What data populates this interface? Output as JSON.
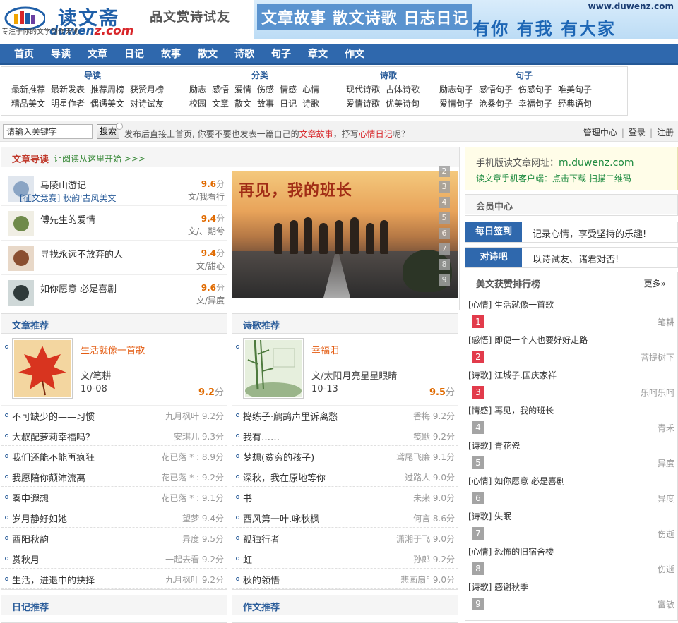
{
  "header": {
    "logo_cn": "读文斋",
    "logo_en_a": "duwen",
    "logo_en_b": "z.com",
    "logo_sub": "专注于你的文学创作天地",
    "slogan": "品文赏诗试友",
    "banner_left": "文章故事 散文诗歌 日志日记",
    "banner_url": "www.duwenz.com",
    "banner_right": "有你 有我 有大家"
  },
  "nav": [
    "首页",
    "导读",
    "文章",
    "日记",
    "故事",
    "散文",
    "诗歌",
    "句子",
    "章文",
    "作文"
  ],
  "categories": [
    {
      "title": "导读",
      "rows": [
        [
          "最新推荐",
          "最新发表",
          "推荐周榜",
          "获赞月榜"
        ],
        [
          "精品美文",
          "明星作者",
          "偶遇美文",
          "对诗试友"
        ]
      ]
    },
    {
      "title": "分类",
      "rows": [
        [
          "励志",
          "感悟",
          "爱情",
          "伤感",
          "情感",
          "心情"
        ],
        [
          "校园",
          "文章",
          "散文",
          "故事",
          "日记",
          "诗歌"
        ]
      ]
    },
    {
      "title": "诗歌",
      "rows": [
        [
          "现代诗歌",
          "古体诗歌"
        ],
        [
          "爱情诗歌",
          "优美诗句"
        ]
      ]
    },
    {
      "title": "句子",
      "rows": [
        [
          "励志句子",
          "感悟句子",
          "伤感句子",
          "唯美句子"
        ],
        [
          "爱情句子",
          "沧桑句子",
          "幸福句子",
          "经典语句"
        ]
      ]
    }
  ],
  "search": {
    "placeholder": "请输入关键字",
    "button": "搜索",
    "tip_a": "发布后直接上首页, 你要不要也发表一篇自己的",
    "tip_red1": "文章故事",
    "tip_b": "，抒写",
    "tip_red2": "心情日记",
    "tip_c": "呢？",
    "links": [
      "管理中心",
      "登录",
      "注册"
    ]
  },
  "guide": {
    "title": "文章导读",
    "subtitle": "让阅读从这里开始 >>>",
    "items": [
      {
        "name": "马陵山游记",
        "extra": "[征文竞赛] 秋韵'古风美文",
        "score": "9.6",
        "unit": "分",
        "author": "文/我看行"
      },
      {
        "name": "傅先生的爱情",
        "extra": "",
        "score": "9.4",
        "unit": "分",
        "author": "文/、期兮"
      },
      {
        "name": "寻找永远不放弃的人",
        "extra": "",
        "score": "9.4",
        "unit": "分",
        "author": "文/甜心"
      },
      {
        "name": "如你愿意 必是喜剧",
        "extra": "",
        "score": "9.6",
        "unit": "分",
        "author": "文/异度"
      }
    ],
    "hero_title": "再见，我的班长",
    "hero_nums": [
      "2",
      "3",
      "4",
      "5",
      "6",
      "7",
      "8",
      "9"
    ]
  },
  "articles": {
    "title": "文章推荐",
    "feature": {
      "title": "生活就像一首歌",
      "author": "文/笔耕",
      "date": "10-08",
      "score": "9.2",
      "unit": "分"
    },
    "rows": [
      {
        "title": "不可缺少的——习惯",
        "meta": "九月枫叶 9.2分"
      },
      {
        "title": "大叔配萝莉幸福吗？",
        "meta": "安琪儿 9.3分"
      },
      {
        "title": "我们还能不能再疯狂",
        "meta": "花已落 * : 8.9分"
      },
      {
        "title": "我愿陪你颠沛流离",
        "meta": "花已落 * : 9.2分"
      },
      {
        "title": "雾中遐想",
        "meta": "花已落 * : 9.1分"
      },
      {
        "title": "岁月静好如她",
        "meta": "望梦 9.4分"
      },
      {
        "title": "酉阳秋韵",
        "meta": "异度 9.5分"
      },
      {
        "title": "赏秋月",
        "meta": "一起去看 9.2分"
      },
      {
        "title": "生活，进退中的抉择",
        "meta": "九月枫叶 9.2分"
      }
    ]
  },
  "poems": {
    "title": "诗歌推荐",
    "feature": {
      "title": "幸福泪",
      "author": "文/太阳月亮星星眼睛",
      "date": "10-13",
      "score": "9.5",
      "unit": "分"
    },
    "rows": [
      {
        "title": "捣练子·鹧鸪声里诉离愁",
        "meta": "香梅 9.2分"
      },
      {
        "title": "我有……",
        "meta": "笺默 9.2分"
      },
      {
        "title": "梦想(贫穷的孩子)",
        "meta": "鸢尾飞廉 9.1分"
      },
      {
        "title": "深秋，我在原地等你",
        "meta": "过路人 9.0分"
      },
      {
        "title": "书",
        "meta": "未来 9.0分"
      },
      {
        "title": "西风第一叶.咏秋枫",
        "meta": "何言 8.6分"
      },
      {
        "title": "孤独行者",
        "meta": "潇湘于飞 9.0分"
      },
      {
        "title": "虹",
        "meta": "孙郎 9.2分"
      },
      {
        "title": "秋的领悟",
        "meta": "悲画扇° 9.0分"
      }
    ]
  },
  "bottom": {
    "diary_title": "日记推荐",
    "essay_title": "作文推荐"
  },
  "sidebar": {
    "mobile_l1a": "手机版读文章网址：",
    "mobile_l1b": "m.duwenz.com",
    "mobile_l2a": "读文章手机客户端：",
    "mobile_l2b": "点击下载 扫描二维码",
    "member_title": "会员中心",
    "sign": [
      {
        "tag": "每日签到",
        "text": "记录心情，享受坚持的乐趣!"
      },
      {
        "tag": "对诗吧",
        "text": "以诗试友、诸君对否!"
      }
    ],
    "rank_title": "美文获赞排行榜",
    "rank_more": "更多»",
    "rank": [
      {
        "title": "[心情] 生活就像一首歌",
        "num": "1",
        "author": "笔耕"
      },
      {
        "title": "[感悟] 即便一个人也要好好走路",
        "num": "2",
        "author": "菩提树下"
      },
      {
        "title": "[诗歌] 江城子.国庆家祥",
        "num": "3",
        "author": "乐呵乐呵"
      },
      {
        "title": "[情感] 再见，我的班长",
        "num": "4",
        "author": "青禾"
      },
      {
        "title": "[诗歌] 青花瓷",
        "num": "5",
        "author": "异度"
      },
      {
        "title": "[心情] 如你愿意 必是喜剧",
        "num": "6",
        "author": "异度"
      },
      {
        "title": "[诗歌] 失眠",
        "num": "7",
        "author": "伤逝"
      },
      {
        "title": "[心情] 恐怖的旧宿舍楼",
        "num": "8",
        "author": "伤逝"
      },
      {
        "title": "[诗歌] 感谢秋季",
        "num": "9",
        "author": "富敏"
      }
    ]
  },
  "colors": {
    "brand": "#2f68ad",
    "accent_red": "#d8262a",
    "score": "#e06a00",
    "rank_hot": "#e23b4b"
  }
}
